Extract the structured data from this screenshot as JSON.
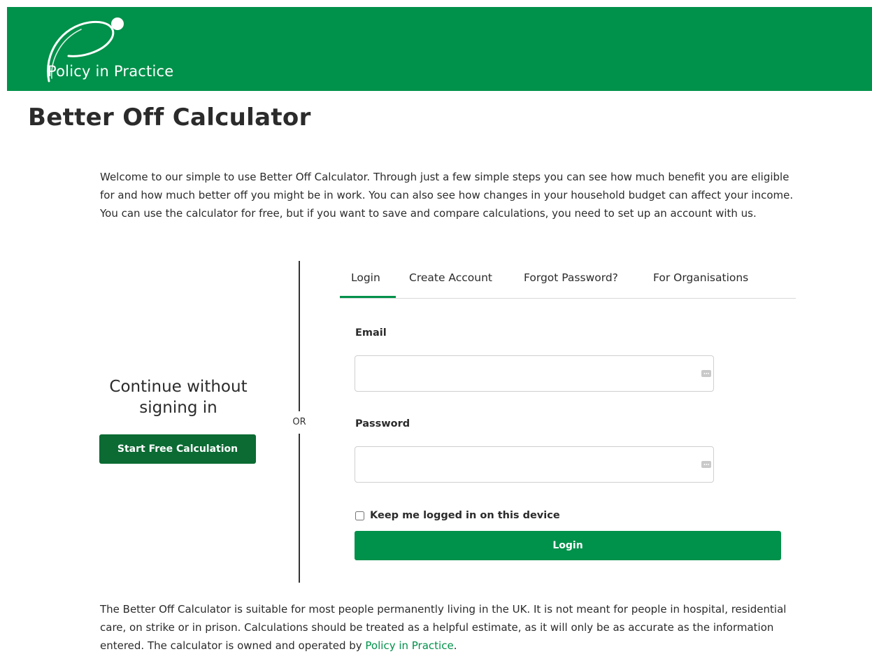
{
  "brand": {
    "name": "Policy in Practice",
    "header_color": "#00914a",
    "accent_color": "#00914a",
    "dark_button_color": "#0b6b33"
  },
  "page": {
    "title": "Better Off Calculator",
    "intro": "Welcome to our simple to use Better Off Calculator. Through just a few simple steps you can see how much benefit you are eligible for and how much better off you might be in work. You can also see how changes in your household budget can affect your income. You can use the calculator for free, but if you want to save and compare calculations, you need to set up an account with us."
  },
  "guest": {
    "heading": "Continue without signing in",
    "button_label": "Start Free Calculation"
  },
  "divider": {
    "label": "OR"
  },
  "tabs": [
    {
      "label": "Login",
      "active": true
    },
    {
      "label": "Create Account",
      "active": false
    },
    {
      "label": "Forgot Password?",
      "active": false
    },
    {
      "label": "For Organisations",
      "active": false
    }
  ],
  "login_form": {
    "email_label": "Email",
    "email_value": "",
    "password_label": "Password",
    "password_value": "",
    "field_icon": "password-manager-key-icon",
    "remember_label": "Keep me logged in on this device",
    "remember_checked": false,
    "submit_label": "Login"
  },
  "footer": {
    "text_before_link": "The Better Off Calculator is suitable for most people permanently living in the UK. It is not meant for people in hospital, residential care, on strike or in prison. Calculations should be treated as a helpful estimate, as it will only be as accurate as the information entered. The calculator is owned and operated by ",
    "link_text": "Policy in Practice",
    "text_after_link": "."
  }
}
